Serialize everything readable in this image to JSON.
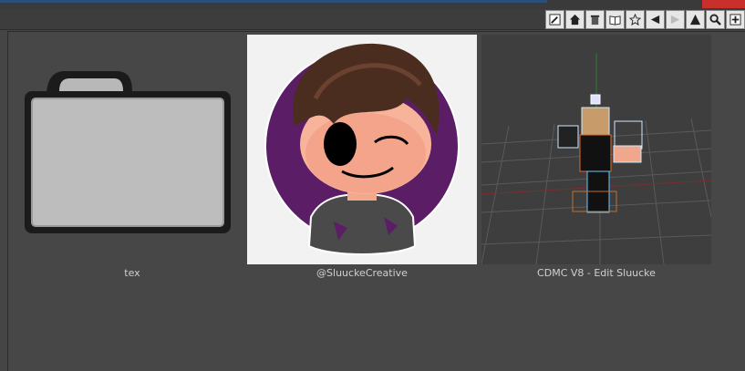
{
  "toolbar": {
    "icons": [
      "pencil-icon",
      "home-icon",
      "trash-icon",
      "book-icon",
      "star-icon",
      "back-icon",
      "forward-icon",
      "up-icon",
      "zoom-icon",
      "add-icon"
    ]
  },
  "items": [
    {
      "label": "tex",
      "kind": "folder"
    },
    {
      "label": "@SluuckeCreative",
      "kind": "image"
    },
    {
      "label": "CDMC V8 - Edit Sluucke",
      "kind": "image"
    }
  ],
  "colors": {
    "background": "#454545",
    "folder": "#bdbdbd",
    "avatar_circle": "#5b1e66"
  }
}
